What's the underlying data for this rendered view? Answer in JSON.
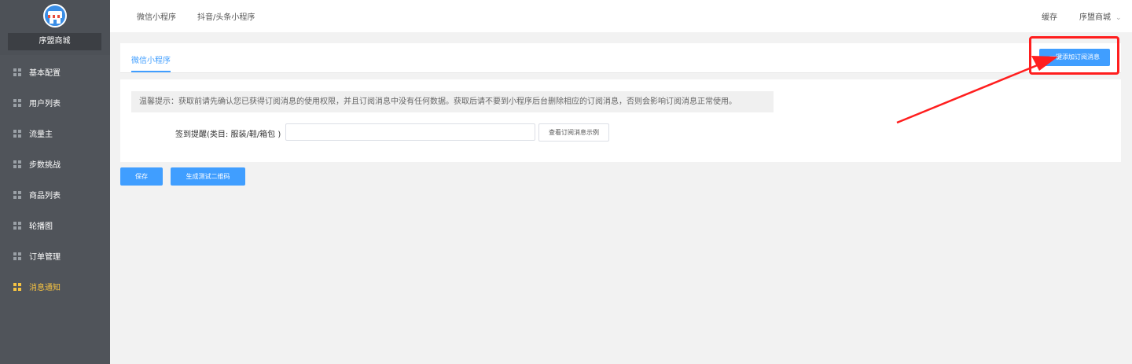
{
  "sidebar": {
    "shop_name": "序盟商城",
    "items": [
      {
        "label": "基本配置",
        "active": false
      },
      {
        "label": "用户列表",
        "active": false
      },
      {
        "label": "流量主",
        "active": false
      },
      {
        "label": "步数挑战",
        "active": false
      },
      {
        "label": "商品列表",
        "active": false
      },
      {
        "label": "轮播图",
        "active": false
      },
      {
        "label": "订单管理",
        "active": false
      },
      {
        "label": "消息通知",
        "active": true
      }
    ]
  },
  "topbar": {
    "tabs": [
      "微信小程序",
      "抖音/头条小程序"
    ],
    "cache_label": "缓存",
    "user_label": "序盟商城"
  },
  "tabs": {
    "active_label": "微信小程序"
  },
  "actions": {
    "add_subscription_label": "一键添加订阅消息"
  },
  "form": {
    "tip": "温馨提示：获取前请先确认您已获得订阅消息的使用权限，并且订阅消息中没有任何数据。获取后请不要到小程序后台删除相应的订阅消息，否则会影响订阅消息正常使用。",
    "field_label": "签到提醒(类目: 服装/鞋/箱包 )",
    "field_value": "",
    "example_button": "查看订阅消息示例"
  },
  "footer": {
    "save_label": "保存",
    "qr_label": "生成测试二维码"
  },
  "colors": {
    "primary": "#409eff",
    "sidebar_bg": "#50545a",
    "active_menu": "#f5c242",
    "annotation": "#ff1e1e"
  }
}
